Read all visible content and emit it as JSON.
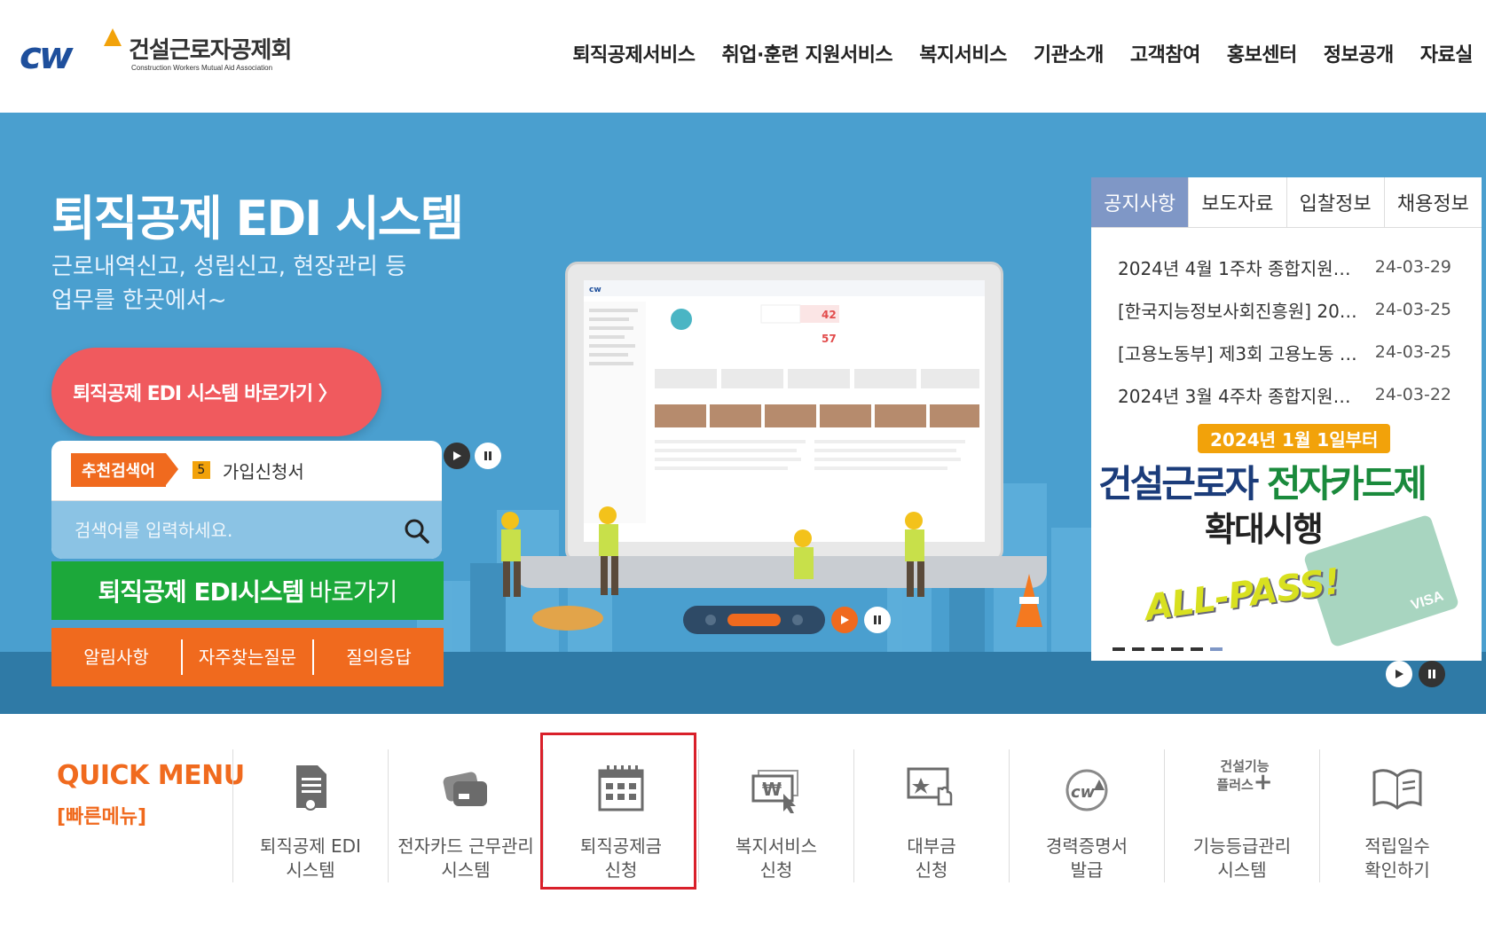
{
  "header": {
    "logo_text": "건설근로자공제회",
    "logo_sub": "Construction Workers Mutual Aid Association",
    "nav": [
      "퇴직공제서비스",
      "취업·훈련 지원서비스",
      "복지서비스",
      "기관소개",
      "고객참여",
      "홍보센터",
      "정보공개",
      "자료실"
    ]
  },
  "hero": {
    "title": "퇴직공제 EDI 시스템",
    "desc_line1": "근로내역신고, 성립신고, 현장관리 등",
    "desc_line2": "업무를 한곳에서~",
    "pill_button": "퇴직공제 EDI 시스템 바로가기 〉",
    "recommend_label": "추천검색어",
    "recommend_rank": "5",
    "recommend_word": "가입신청서",
    "search_placeholder": "검색어를 입력하세요.",
    "green_button_bold": "퇴직공제 EDI시스템",
    "green_button_light": "바로가기",
    "links": [
      "알림사항",
      "자주찾는질문",
      "질의응답"
    ]
  },
  "notice": {
    "tabs": [
      "공지사항",
      "보도자료",
      "입찰정보",
      "채용정보"
    ],
    "active_tab": 0,
    "items": [
      {
        "title": "2024년 4월 1주차 종합지원…",
        "date": "24-03-29"
      },
      {
        "title": "[한국지능정보사회진흥원] 20…",
        "date": "24-03-25"
      },
      {
        "title": "[고용노동부] 제3회 고용노동 …",
        "date": "24-03-25"
      },
      {
        "title": "2024년 3월 4주차 종합지원…",
        "date": "24-03-22"
      }
    ],
    "banner": {
      "date": "2024년 1월 1일부터",
      "line1_a": "건설근로자 ",
      "line1_b": "전자카드제",
      "line2": "확대시행",
      "slogan": "ALL-PASS!",
      "card_brand": "VISA"
    }
  },
  "quick": {
    "title": "QUICK MENU",
    "subtitle": "[빠른메뉴]",
    "items": [
      {
        "line1": "퇴직공제 EDI",
        "line2": "시스템"
      },
      {
        "line1": "전자카드 근무관리",
        "line2": "시스템"
      },
      {
        "line1": "퇴직공제금",
        "line2": "신청"
      },
      {
        "line1": "복지서비스",
        "line2": "신청"
      },
      {
        "line1": "대부금",
        "line2": "신청"
      },
      {
        "line1": "경력증명서",
        "line2": "발급"
      },
      {
        "line1": "기능등급관리",
        "line2": "시스템"
      },
      {
        "line1": "적립일수",
        "line2": "확인하기"
      }
    ],
    "skill_icon_text1": "건설기능",
    "skill_icon_text2": "플러스"
  },
  "colors": {
    "hero_bg": "#4a9fcf",
    "accent_orange": "#f06a1e",
    "green": "#1ca83a",
    "pill_red": "#f05a5e",
    "tab_active": "#7f97c6",
    "highlight": "#d9202a"
  }
}
